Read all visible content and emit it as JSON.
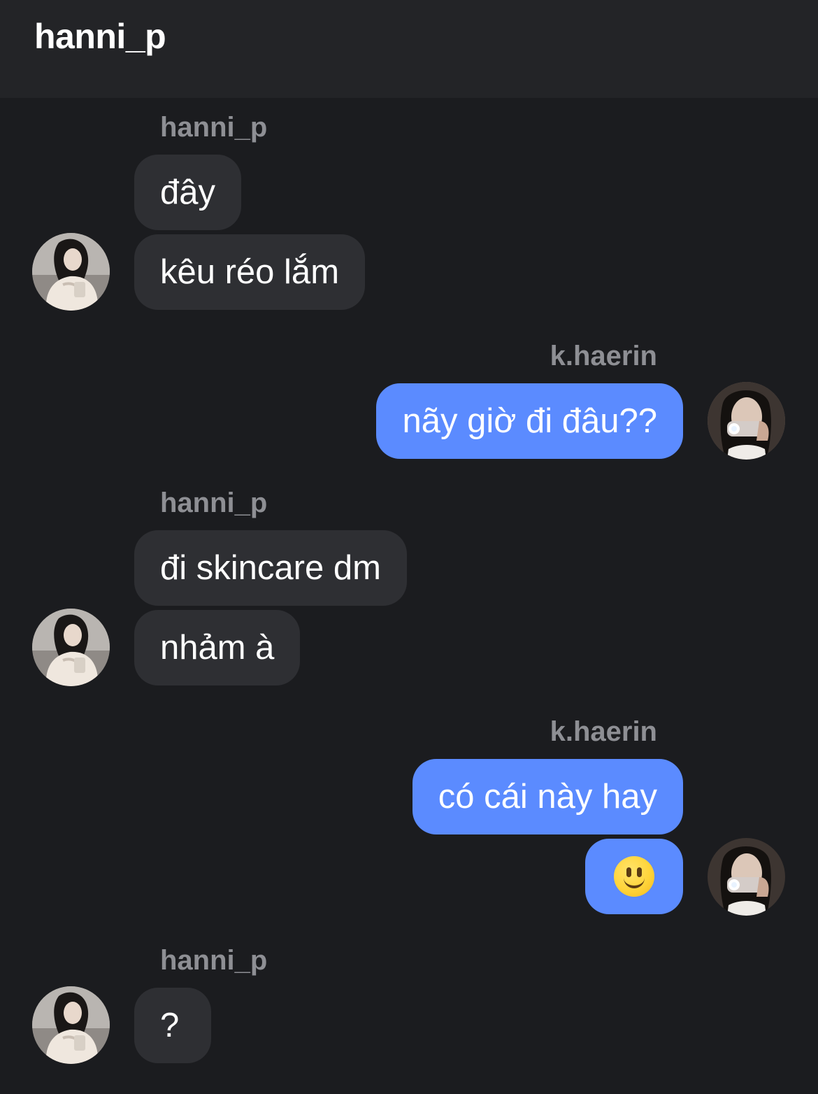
{
  "header": {
    "title": "hanni_p"
  },
  "users": {
    "hanni": "hanni_p",
    "haerin": "k.haerin"
  },
  "messages": [
    "đây",
    "kêu réo lắm",
    "nãy giờ đi đâu??",
    "đi skincare dm",
    "nhảm à",
    "có cái này hay",
    "🙂",
    "?"
  ],
  "colors": {
    "background": "#1b1c1f",
    "header_bg": "#232427",
    "incoming_bubble": "#2e2f33",
    "outgoing_bubble": "#5b8bff",
    "sender_label": "#8e8f94"
  },
  "icons": {
    "emoji": "slightly-smiling-face-icon"
  }
}
